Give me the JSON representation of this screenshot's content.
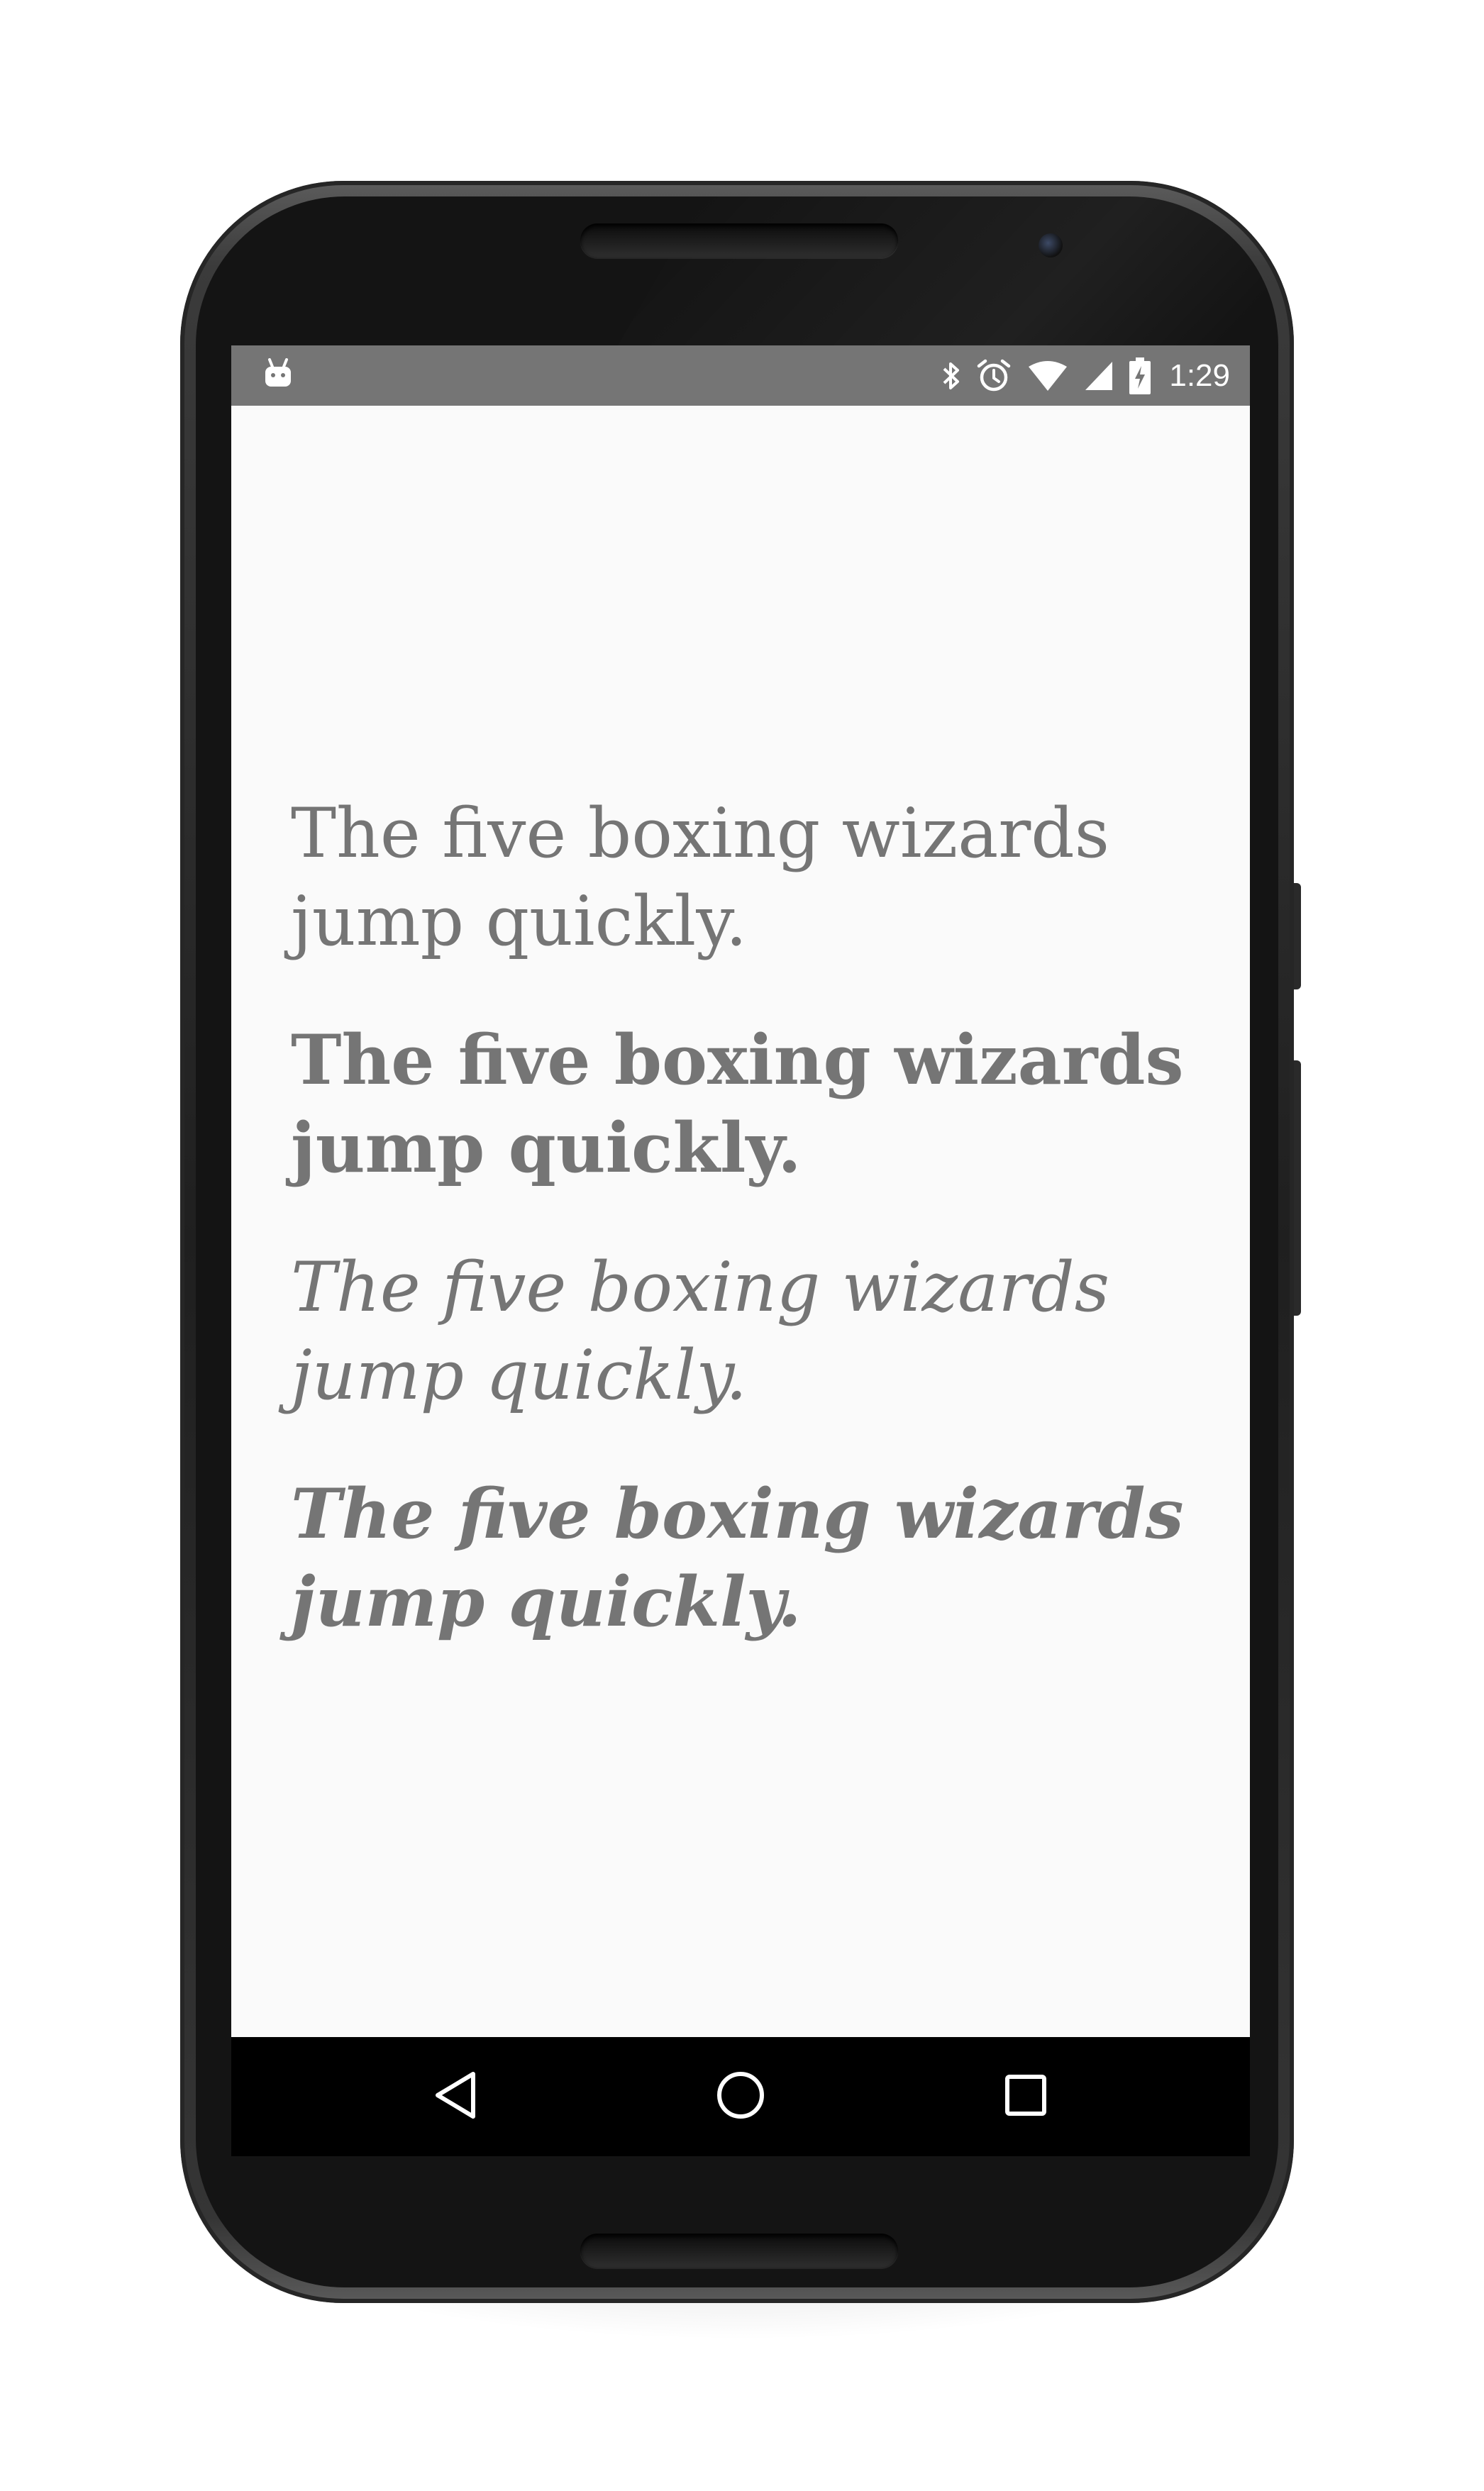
{
  "device": {
    "status_bar": {
      "notification_icon": "android-debug-icon",
      "icons": [
        "bluetooth-icon",
        "alarm-icon",
        "wifi-icon",
        "cell-signal-icon",
        "battery-charging-icon"
      ],
      "time": "1:29"
    },
    "navigation_bar": {
      "back": "back-icon",
      "home": "home-icon",
      "recents": "recents-icon"
    }
  },
  "screen": {
    "background_color": "#fafafa",
    "text_color": "#757575",
    "samples": [
      {
        "style": "regular",
        "text": "The five boxing wizards jump quickly."
      },
      {
        "style": "bold",
        "text": "The five boxing wizards jump quickly."
      },
      {
        "style": "italic",
        "text": "The five boxing wizards jump quickly."
      },
      {
        "style": "bold-italic",
        "text": "The five boxing wizards jump quickly."
      }
    ]
  }
}
